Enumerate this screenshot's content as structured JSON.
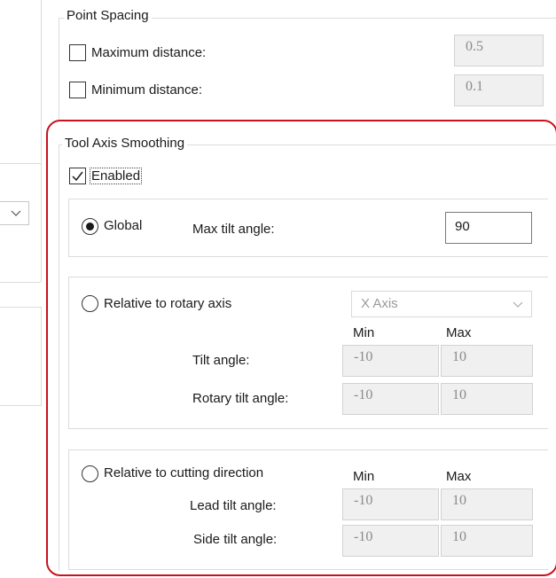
{
  "point_spacing": {
    "title": "Point Spacing",
    "max_distance": {
      "label": "Maximum distance:",
      "value": "0.5",
      "checked": false
    },
    "min_distance": {
      "label": "Minimum distance:",
      "value": "0.1",
      "checked": false
    }
  },
  "tool_axis_smoothing": {
    "title": "Tool Axis Smoothing",
    "enabled": {
      "label": "Enabled",
      "checked": true
    },
    "global": {
      "label": "Global",
      "selected": true,
      "max_tilt_label": "Max tilt angle:",
      "max_tilt_value": "90"
    },
    "rotary": {
      "label": "Relative to rotary axis",
      "selected": false,
      "axis_select": "X Axis",
      "min_header": "Min",
      "max_header": "Max",
      "tilt_label": "Tilt angle:",
      "tilt_min": "-10",
      "tilt_max": "10",
      "rotary_tilt_label": "Rotary tilt angle:",
      "rotary_tilt_min": "-10",
      "rotary_tilt_max": "10"
    },
    "cutting": {
      "label": "Relative to cutting direction",
      "selected": false,
      "min_header": "Min",
      "max_header": "Max",
      "lead_tilt_label": "Lead tilt angle:",
      "lead_tilt_min": "-10",
      "lead_tilt_max": "10",
      "side_tilt_label": "Side tilt angle:",
      "side_tilt_min": "-10",
      "side_tilt_max": "10"
    }
  },
  "colors": {
    "highlight": "#c8121e",
    "disabled_field": "#f0f0f0"
  }
}
